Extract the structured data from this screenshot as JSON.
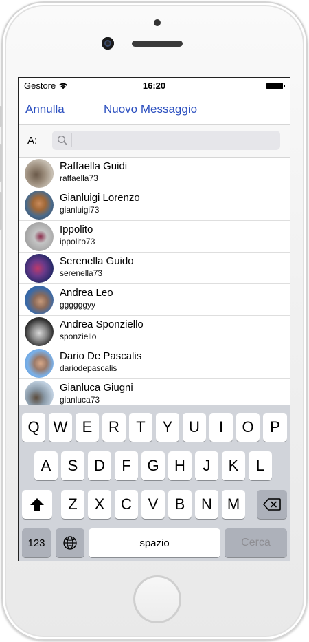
{
  "status_bar": {
    "carrier": "Gestore",
    "time": "16:20"
  },
  "nav": {
    "cancel": "Annulla",
    "title": "Nuovo Messaggio"
  },
  "to_row": {
    "label": "A:",
    "search_value": ""
  },
  "contacts": [
    {
      "name": "Raffaella Guidi",
      "username": "raffaella73"
    },
    {
      "name": "Gianluigi Lorenzo",
      "username": "gianluigi73"
    },
    {
      "name": "Ippolito",
      "username": "ippolito73"
    },
    {
      "name": "Serenella Guido",
      "username": "serenella73"
    },
    {
      "name": "Andrea Leo",
      "username": "ggggggyy"
    },
    {
      "name": "Andrea Sponziello",
      "username": "sponziello"
    },
    {
      "name": "Dario De Pascalis",
      "username": "dariodepascalis"
    },
    {
      "name": "Gianluca Giugni",
      "username": "gianluca73"
    }
  ],
  "keyboard": {
    "row1": [
      "Q",
      "W",
      "E",
      "R",
      "T",
      "Y",
      "U",
      "I",
      "O",
      "P"
    ],
    "row2": [
      "A",
      "S",
      "D",
      "F",
      "G",
      "H",
      "J",
      "K",
      "L"
    ],
    "row3": [
      "Z",
      "X",
      "C",
      "V",
      "B",
      "N",
      "M"
    ],
    "numbers_key": "123",
    "space_key": "spazio",
    "return_key": "Cerca"
  },
  "colors": {
    "accent": "#2b4fbf",
    "keyboard_bg": "#d1d4da",
    "key_dark": "#adb1ba"
  },
  "icons": [
    "wifi-icon",
    "battery-icon",
    "search-icon",
    "shift-icon",
    "backspace-icon",
    "globe-icon"
  ]
}
